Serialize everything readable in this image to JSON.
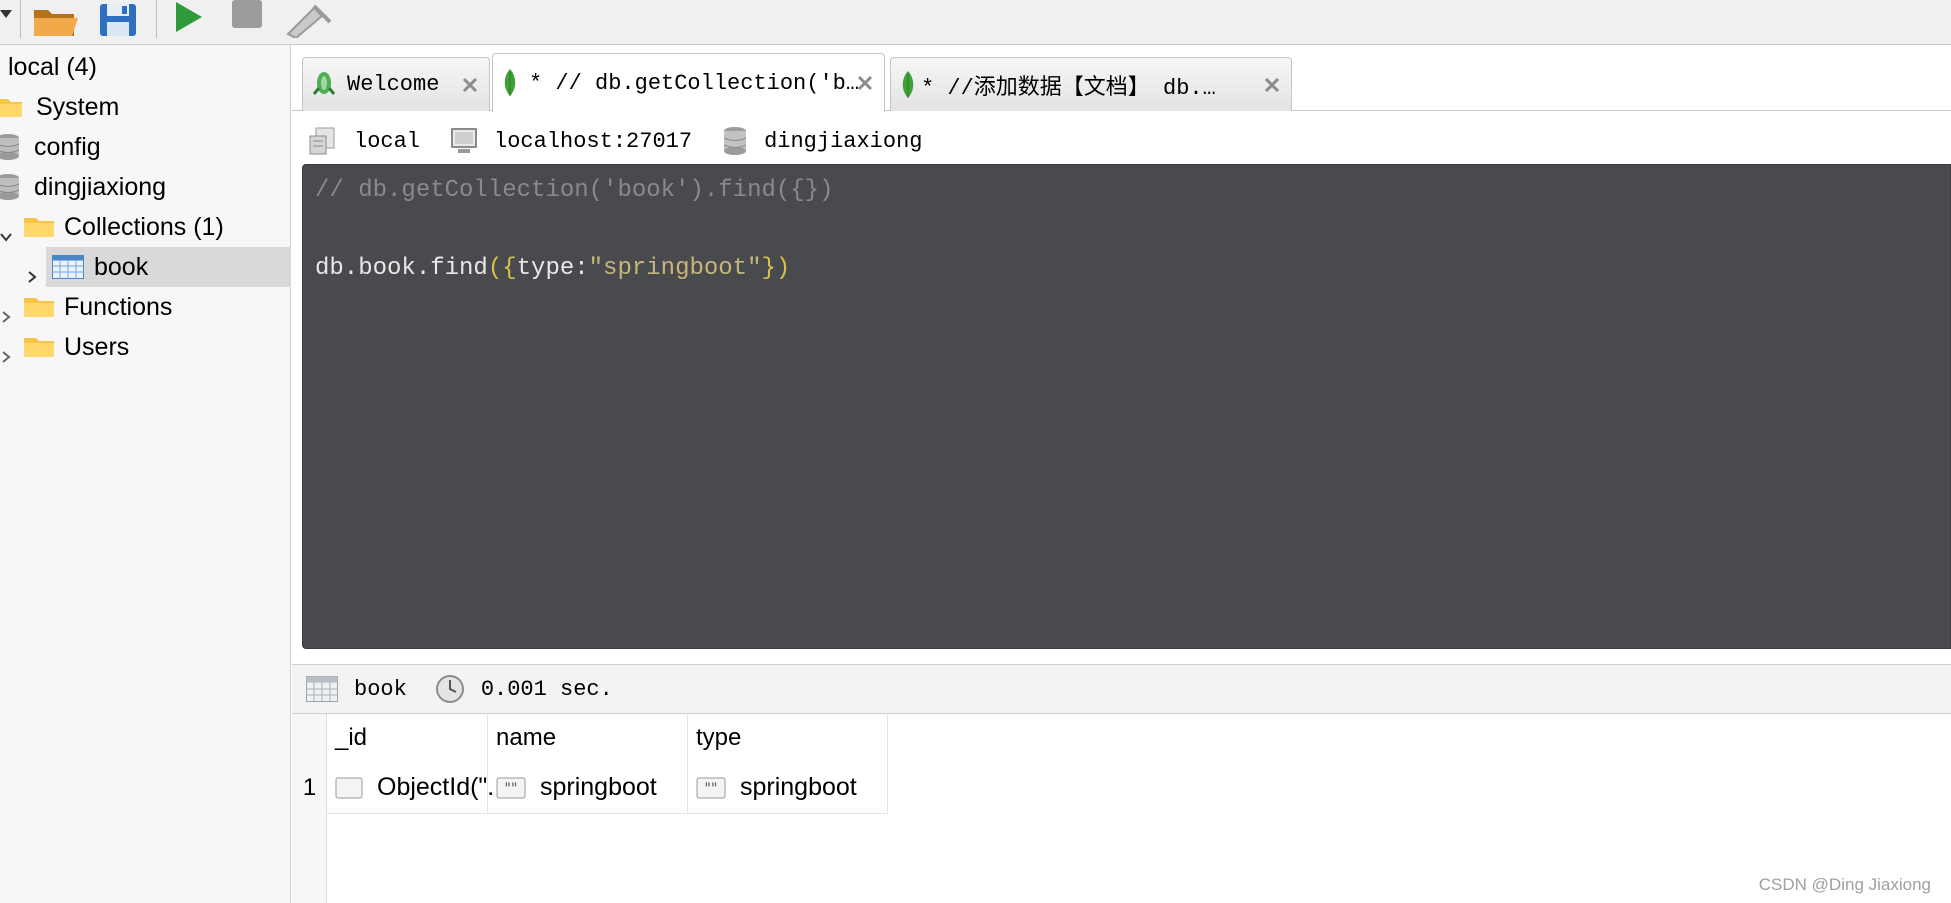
{
  "toolbar": {
    "items": [
      {
        "name": "dropdown-icon"
      },
      {
        "name": "open-folder-icon"
      },
      {
        "name": "save-icon"
      },
      {
        "name": "run-icon"
      },
      {
        "name": "stop-icon"
      },
      {
        "name": "explain-icon"
      }
    ]
  },
  "tree": {
    "root": "local (4)",
    "system": "System",
    "config": "config",
    "db": "dingjiaxiong",
    "collections": "Collections (1)",
    "collection_book": "book",
    "functions": "Functions",
    "users": "Users"
  },
  "tabs": [
    {
      "label": "Welcome",
      "icon": "leaf-rocket-icon"
    },
    {
      "label": "* // db.getCollection('b…",
      "icon": "mongodb-leaf-icon"
    },
    {
      "label": "* //添加数据【文档】  db.…",
      "icon": "mongodb-leaf-icon"
    }
  ],
  "connection": {
    "name": "local",
    "host": "localhost:27017",
    "database": "dingjiaxiong"
  },
  "editor": {
    "line1": "// db.getCollection('book').find({})",
    "line3_db": "db.book.find",
    "line3_open": "({",
    "line3_key": "type:",
    "line3_string": "\"springboot\"",
    "line3_close": "})"
  },
  "result": {
    "collection": "book",
    "time": "0.001 sec."
  },
  "grid": {
    "columns": [
      "_id",
      "name",
      "type"
    ],
    "rows": [
      {
        "index": "1",
        "id": "ObjectId(\"...",
        "name": "springboot",
        "type": "springboot"
      }
    ]
  },
  "watermark": "CSDN @Ding Jiaxiong",
  "colors": {
    "editor_bg": "#484a4d",
    "mongo_green": "#3fa037",
    "folder_yellow": "#f6c644",
    "selection_bg": "#d9d9d9"
  }
}
